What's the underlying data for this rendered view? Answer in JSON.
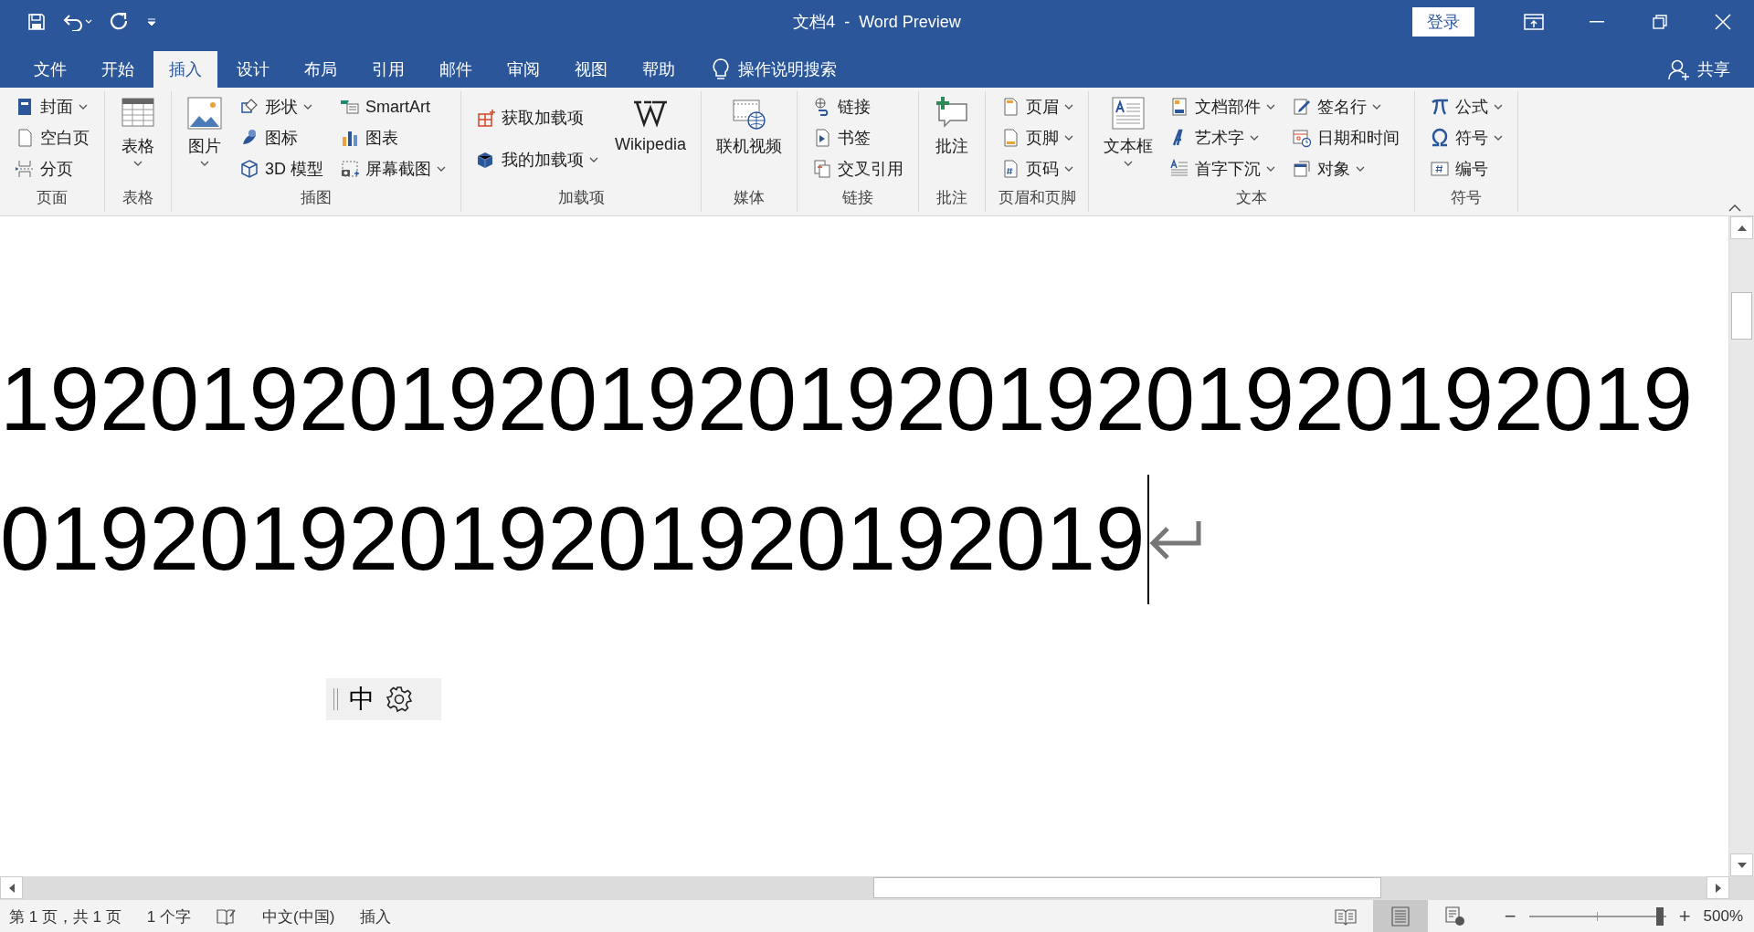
{
  "window": {
    "title": "文档4  -  Word Preview",
    "login": "登录"
  },
  "tabs": [
    {
      "label": "文件",
      "selected": false
    },
    {
      "label": "开始",
      "selected": false
    },
    {
      "label": "插入",
      "selected": true
    },
    {
      "label": "设计",
      "selected": false
    },
    {
      "label": "布局",
      "selected": false
    },
    {
      "label": "引用",
      "selected": false
    },
    {
      "label": "邮件",
      "selected": false
    },
    {
      "label": "审阅",
      "selected": false
    },
    {
      "label": "视图",
      "selected": false
    },
    {
      "label": "帮助",
      "selected": false
    }
  ],
  "tell_me": "操作说明搜索",
  "share": "共享",
  "ribbon": [
    {
      "label": "页面",
      "columns": [
        {
          "kind": "stack",
          "items": [
            {
              "label": "封面",
              "dropdown": true
            },
            {
              "label": "空白页",
              "dropdown": false
            },
            {
              "label": "分页",
              "dropdown": false
            }
          ]
        }
      ]
    },
    {
      "label": "表格",
      "columns": [
        {
          "kind": "large",
          "items": [
            {
              "label": "表格",
              "dropdown": true
            }
          ]
        }
      ]
    },
    {
      "label": "插图",
      "columns": [
        {
          "kind": "large",
          "items": [
            {
              "label": "图片",
              "dropdown": true
            }
          ]
        },
        {
          "kind": "stack",
          "items": [
            {
              "label": "形状",
              "dropdown": true
            },
            {
              "label": "图标",
              "dropdown": false
            },
            {
              "label": "3D 模型",
              "dropdown": false
            }
          ]
        },
        {
          "kind": "stack",
          "items": [
            {
              "label": "SmartArt",
              "dropdown": false
            },
            {
              "label": "图表",
              "dropdown": false
            },
            {
              "label": "屏幕截图",
              "dropdown": true
            }
          ]
        }
      ]
    },
    {
      "label": "加载项",
      "columns": [
        {
          "kind": "pair",
          "items": [
            {
              "label": "获取加载项",
              "dropdown": false
            },
            {
              "label": "我的加载项",
              "dropdown": true
            }
          ]
        },
        {
          "kind": "large",
          "items": [
            {
              "label": "Wikipedia",
              "dropdown": false
            }
          ]
        }
      ]
    },
    {
      "label": "媒体",
      "columns": [
        {
          "kind": "large",
          "items": [
            {
              "label": "联机视频",
              "dropdown": false
            }
          ]
        }
      ]
    },
    {
      "label": "链接",
      "columns": [
        {
          "kind": "stack",
          "items": [
            {
              "label": "链接",
              "dropdown": false
            },
            {
              "label": "书签",
              "dropdown": false
            },
            {
              "label": "交叉引用",
              "dropdown": false
            }
          ]
        }
      ]
    },
    {
      "label": "批注",
      "columns": [
        {
          "kind": "large",
          "items": [
            {
              "label": "批注",
              "dropdown": false
            }
          ]
        }
      ]
    },
    {
      "label": "页眉和页脚",
      "columns": [
        {
          "kind": "stack",
          "items": [
            {
              "label": "页眉",
              "dropdown": true
            },
            {
              "label": "页脚",
              "dropdown": true
            },
            {
              "label": "页码",
              "dropdown": true
            }
          ]
        }
      ]
    },
    {
      "label": "文本",
      "columns": [
        {
          "kind": "large",
          "items": [
            {
              "label": "文本框",
              "dropdown": true
            }
          ]
        },
        {
          "kind": "stack",
          "items": [
            {
              "label": "文档部件",
              "dropdown": true
            },
            {
              "label": "艺术字",
              "dropdown": true
            },
            {
              "label": "首字下沉",
              "dropdown": true
            }
          ]
        },
        {
          "kind": "stack",
          "items": [
            {
              "label": "签名行",
              "dropdown": true
            },
            {
              "label": "日期和时间",
              "dropdown": false
            },
            {
              "label": "对象",
              "dropdown": true
            }
          ]
        }
      ]
    },
    {
      "label": "符号",
      "columns": [
        {
          "kind": "stack",
          "items": [
            {
              "label": "公式",
              "dropdown": true
            },
            {
              "label": "符号",
              "dropdown": true
            },
            {
              "label": "编号",
              "dropdown": false
            }
          ]
        }
      ]
    }
  ],
  "document": {
    "lines": [
      "1920192019201920192019201920192019",
      "01920192019201920192019"
    ]
  },
  "ime": {
    "mode": "中"
  },
  "status_bar": {
    "page": "第 1 页，共 1 页",
    "words": "1 个字",
    "language": "中文(中国)",
    "mode": "插入",
    "views": [
      {
        "kind": "read",
        "selected": false
      },
      {
        "kind": "print",
        "selected": true
      },
      {
        "kind": "web",
        "selected": false
      }
    ],
    "zoom": {
      "out": "−",
      "in": "+",
      "level": 0.98,
      "reading": "500%"
    }
  }
}
